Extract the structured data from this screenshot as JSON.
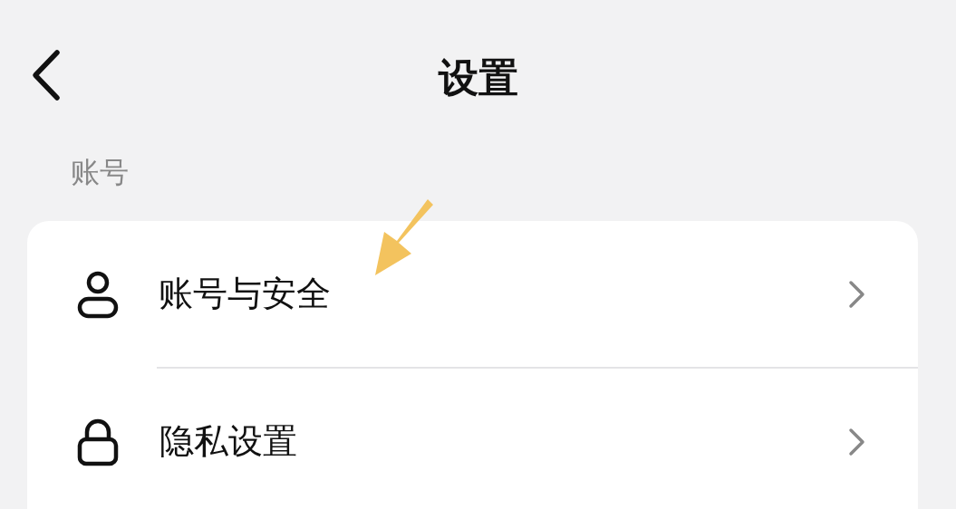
{
  "header": {
    "title": "设置"
  },
  "section": {
    "title": "账号",
    "items": [
      {
        "kind": "user",
        "label": "账号与安全"
      },
      {
        "kind": "lock",
        "label": "隐私设置"
      }
    ]
  }
}
